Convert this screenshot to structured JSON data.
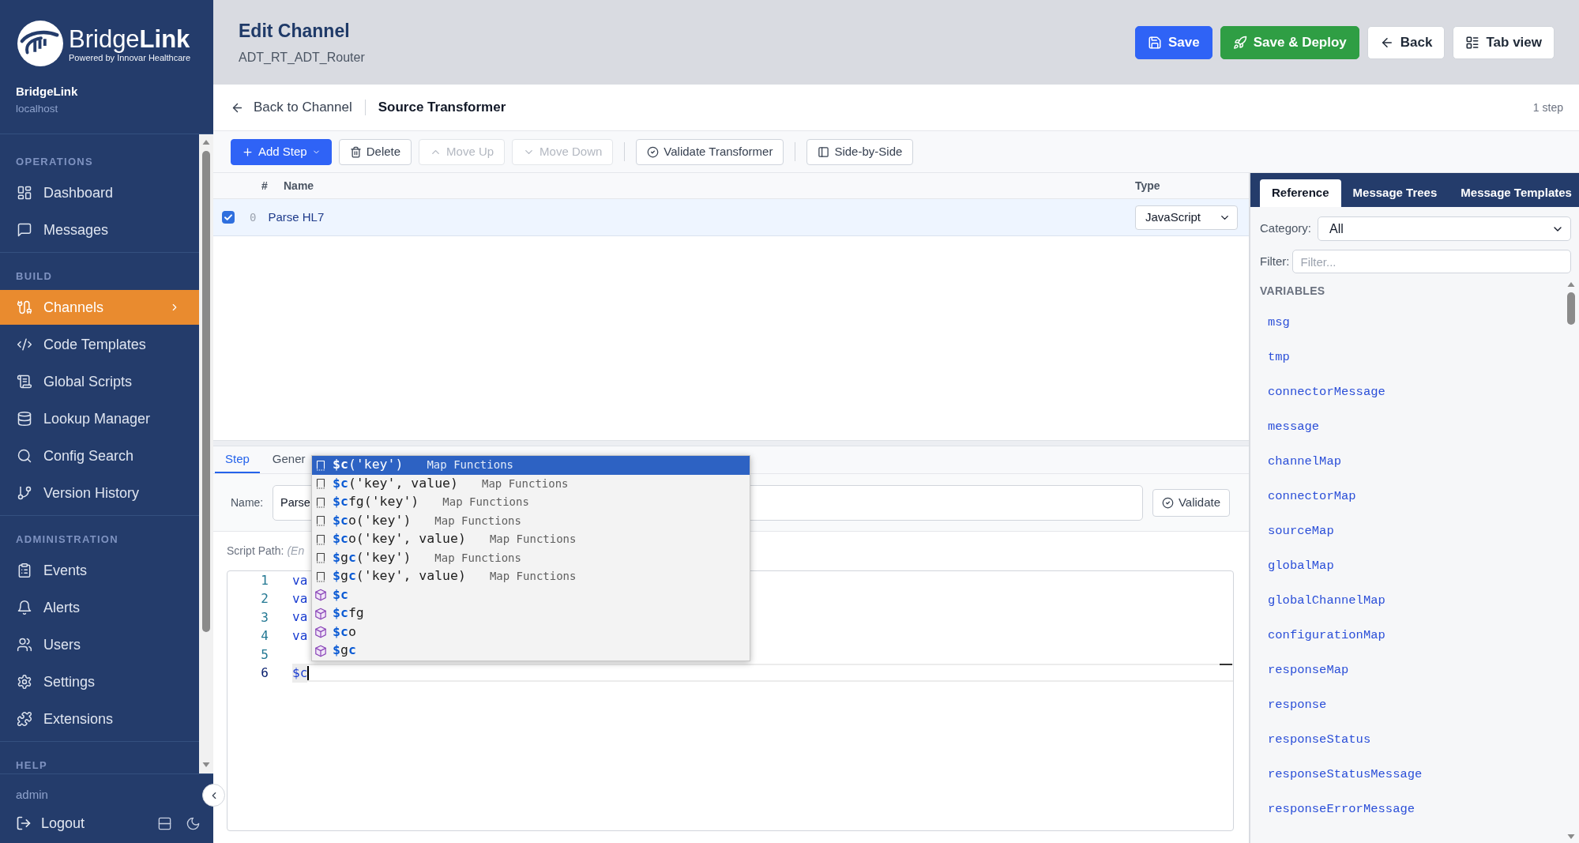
{
  "sidebar": {
    "logo": {
      "wordmark": "Bridge**Link**",
      "tagline": "Powered by Innovar Healthcare"
    },
    "server": {
      "name": "BridgeLink",
      "host": "localhost"
    },
    "sections": [
      {
        "title": "OPERATIONS",
        "items": [
          {
            "label": "Dashboard",
            "selected": false
          },
          {
            "label": "Messages",
            "selected": false
          }
        ]
      },
      {
        "title": "BUILD",
        "items": [
          {
            "label": "Channels",
            "selected": true
          },
          {
            "label": "Code Templates",
            "selected": false
          },
          {
            "label": "Global Scripts",
            "selected": false
          },
          {
            "label": "Lookup Manager",
            "selected": false
          },
          {
            "label": "Config Search",
            "selected": false
          },
          {
            "label": "Version History",
            "selected": false
          }
        ]
      },
      {
        "title": "ADMINISTRATION",
        "items": [
          {
            "label": "Events",
            "selected": false
          },
          {
            "label": "Alerts",
            "selected": false
          },
          {
            "label": "Users",
            "selected": false
          },
          {
            "label": "Settings",
            "selected": false
          },
          {
            "label": "Extensions",
            "selected": false
          }
        ]
      },
      {
        "title": "HELP"
      }
    ],
    "user": "admin",
    "logout": "Logout"
  },
  "header": {
    "title": "Edit Channel",
    "subtitle": "ADT_RT_ADT_Router",
    "buttons": [
      {
        "label": "Save",
        "kind": "primary"
      },
      {
        "label": "Save & Deploy",
        "kind": "success"
      },
      {
        "label": "Back",
        "kind": "default"
      },
      {
        "label": "Tab view",
        "kind": "default"
      }
    ]
  },
  "breadcrumb": {
    "back": "Back to Channel",
    "current": "Source Transformer",
    "step_count": "1 step"
  },
  "toolbar": {
    "groups": [
      [
        {
          "label": "Add Step",
          "kind": "menu",
          "disabled": false
        },
        {
          "label": "Delete",
          "kind": "default",
          "disabled": false
        },
        {
          "label": "Move Up",
          "kind": "default",
          "disabled": true
        },
        {
          "label": "Move Down",
          "kind": "default",
          "disabled": true
        }
      ],
      [
        {
          "label": "Validate Transformer",
          "kind": "default",
          "disabled": false
        }
      ],
      [
        {
          "label": "Side-by-Side",
          "kind": "default",
          "disabled": false
        }
      ]
    ]
  },
  "steps": {
    "columns": [
      "#",
      "Name",
      "Type"
    ],
    "rows": [
      {
        "number": "0",
        "name": "Parse HL7",
        "type": "JavaScript",
        "checked": true,
        "selected": true
      }
    ]
  },
  "step_editor": {
    "tabs": [
      {
        "label": "Step",
        "selected": true
      },
      {
        "label": "Gener",
        "selected": false
      }
    ],
    "name_field": {
      "label": "Name:",
      "value": "Parse"
    },
    "validate_button": "Validate",
    "script_path": {
      "label": "Script Path:",
      "hint": "(En"
    },
    "code_lines": [
      {
        "number": "1",
        "text": "va",
        "current": false
      },
      {
        "number": "2",
        "text": "va",
        "current": false
      },
      {
        "number": "3",
        "text": "va",
        "current": false
      },
      {
        "number": "4",
        "text": "va",
        "current": false
      },
      {
        "number": "5",
        "current": false
      },
      {
        "number": "6",
        "text": "$c",
        "current": true
      }
    ],
    "autocomplete": [
      {
        "label": "**$c**('key')",
        "detail": "Map Functions",
        "kind": "function",
        "selected": true
      },
      {
        "label": "**$c**('key', value)",
        "detail": "Map Functions",
        "kind": "function",
        "selected": false
      },
      {
        "label": "**$c**fg('key')",
        "detail": "Map Functions",
        "kind": "function",
        "selected": false
      },
      {
        "label": "**$c**o('key')",
        "detail": "Map Functions",
        "kind": "function",
        "selected": false
      },
      {
        "label": "**$c**o('key', value)",
        "detail": "Map Functions",
        "kind": "function",
        "selected": false
      },
      {
        "label": "**$**g**c**('key')",
        "detail": "Map Functions",
        "kind": "function",
        "selected": false
      },
      {
        "label": "**$**g**c**('key', value)",
        "detail": "Map Functions",
        "kind": "function",
        "selected": false
      },
      {
        "label": "**$c**",
        "kind": "variable",
        "selected": false
      },
      {
        "label": "**$c**fg",
        "kind": "variable",
        "selected": false
      },
      {
        "label": "**$c**o",
        "kind": "variable",
        "selected": false
      },
      {
        "label": "**$**g**c**",
        "kind": "variable",
        "selected": false
      }
    ]
  },
  "reference_panel": {
    "tabs": [
      {
        "label": "Reference",
        "selected": true
      },
      {
        "label": "Message Trees",
        "selected": false
      },
      {
        "label": "Message Templates",
        "selected": false
      }
    ],
    "category": {
      "label": "Category:",
      "value": "All"
    },
    "filter": {
      "label": "Filter:",
      "placeholder": "Filter..."
    },
    "section_title": "VARIABLES",
    "items": [
      "msg",
      "tmp",
      "connectorMessage",
      "message",
      "channelMap",
      "connectorMap",
      "sourceMap",
      "globalMap",
      "globalChannelMap",
      "configurationMap",
      "responseMap",
      "response",
      "responseStatus",
      "responseStatusMessage",
      "responseErrorMessage"
    ]
  }
}
